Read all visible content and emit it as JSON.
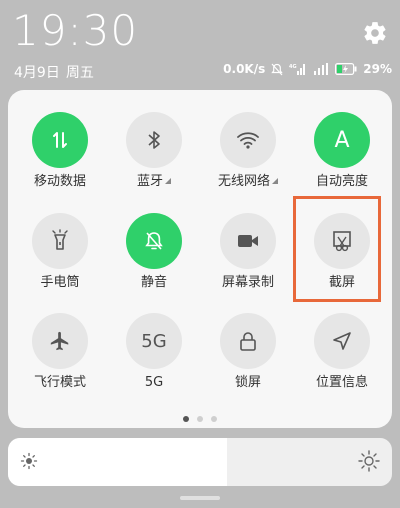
{
  "status": {
    "time": "19:30",
    "date": "4月9日",
    "weekday": "周五",
    "net_speed": "0.0K/s",
    "battery": "29%"
  },
  "tiles": [
    {
      "label": "移动数据",
      "icon": "mobile-data-icon",
      "active": true
    },
    {
      "label": "蓝牙",
      "icon": "bluetooth-icon",
      "active": false
    },
    {
      "label": "无线网络",
      "icon": "wifi-icon",
      "active": false
    },
    {
      "label": "自动亮度",
      "icon": "auto-brightness-icon",
      "active": true
    },
    {
      "label": "手电筒",
      "icon": "flashlight-icon",
      "active": false
    },
    {
      "label": "静音",
      "icon": "mute-bell-icon",
      "active": true
    },
    {
      "label": "屏幕录制",
      "icon": "screen-record-icon",
      "active": false
    },
    {
      "label": "截屏",
      "icon": "screenshot-icon",
      "active": false
    },
    {
      "label": "飞行模式",
      "icon": "airplane-icon",
      "active": false
    },
    {
      "label": "5G",
      "icon": "5g-icon",
      "active": false
    },
    {
      "label": "锁屏",
      "icon": "lock-icon",
      "active": false
    },
    {
      "label": "位置信息",
      "icon": "location-icon",
      "active": false
    }
  ],
  "tile_icon_text": {
    "five_g": "5G",
    "auto_brightness": "A"
  },
  "brightness": {
    "level": 0.57
  },
  "pager": {
    "pages": 3,
    "current": 1
  },
  "colors": {
    "active": "#2fd06a",
    "highlight": "#e8683a",
    "inactive": "#e6e6e6"
  }
}
